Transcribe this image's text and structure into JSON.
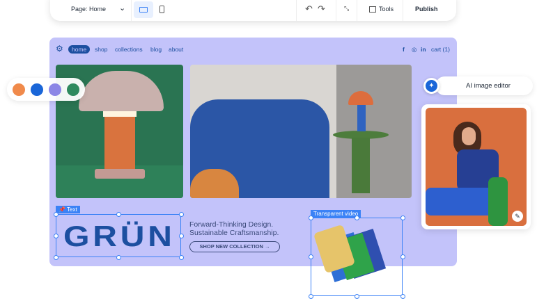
{
  "toolbar": {
    "page_select": "Page: Home",
    "tools": "Tools",
    "publish": "Publish",
    "icons": [
      "chevron-down-icon",
      "desktop-icon",
      "mobile-icon",
      "undo-icon",
      "redo-icon",
      "collapse-icon",
      "tools-icon"
    ]
  },
  "site": {
    "nav": [
      "home",
      "shop",
      "collections",
      "blog",
      "about"
    ],
    "cart": "cart (1)",
    "logo_text": "GRÜN",
    "tagline_1": "Forward-Thinking Design.",
    "tagline_2": "Sustainable Craftsmanship.",
    "cta": "SHOP NEW COLLECTION →"
  },
  "selection": {
    "text_tag": "Text",
    "video_tag": "Transparent video"
  },
  "palette": {
    "colors": [
      "#f08a4b",
      "#1a66d8",
      "#8b86e6",
      "#2e8a5e"
    ]
  },
  "ai": {
    "label": "AI image editor"
  },
  "colors": {
    "canvas": "#c3c3fa",
    "brand": "#1c4fa0",
    "selection": "#3b82f6"
  }
}
